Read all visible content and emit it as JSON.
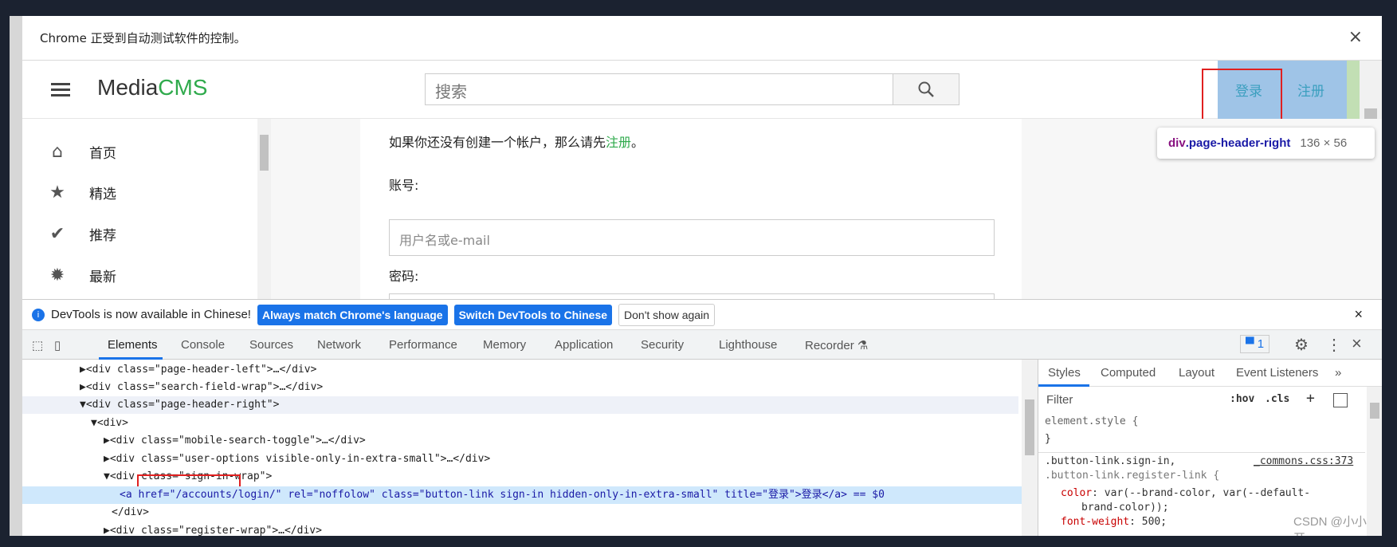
{
  "infobar": {
    "text": "Chrome 正受到自动测试软件的控制。",
    "close": "×"
  },
  "header": {
    "logo_a": "Media",
    "logo_b": "CMS",
    "search_placeholder": "搜索",
    "login": "登录",
    "register": "注册"
  },
  "sidebar": {
    "items": [
      {
        "label": "首页",
        "icon": "home-icon"
      },
      {
        "label": "精选",
        "icon": "star-icon"
      },
      {
        "label": "推荐",
        "icon": "check-icon"
      },
      {
        "label": "最新",
        "icon": "new-icon"
      }
    ]
  },
  "form": {
    "prompt": "如果你还没有创建一个帐户，那么请先",
    "prompt_link": "注册",
    "prompt_end": "。",
    "account_label": "账号:",
    "account_placeholder": "用户名或e-mail",
    "password_label": "密码:"
  },
  "tooltip": {
    "selector_tag": "div",
    "selector_class": ".page-header-right",
    "size": "136 × 56"
  },
  "banner": {
    "text": "DevTools is now available in Chinese!",
    "btn1": "Always match Chrome's language",
    "btn2": "Switch DevTools to Chinese",
    "btn3": "Don't show again",
    "close": "×"
  },
  "devtools": {
    "tabs": [
      "Elements",
      "Console",
      "Sources",
      "Network",
      "Performance",
      "Memory",
      "Application",
      "Security",
      "Lighthouse",
      "Recorder ⚗"
    ],
    "issues": "1"
  },
  "elements": {
    "rows": [
      "▶<div class=\"page-header-left\">…</div>",
      "▶<div class=\"search-field-wrap\">…</div>",
      "▼<div class=\"page-header-right\">",
      "▼<div>",
      "▶<div class=\"mobile-search-toggle\">…</div>",
      "▶<div class=\"user-options visible-only-in-extra-small\">…</div>",
      "▼<div class=\"sign-in-wrap\">",
      "<a href=\"/accounts/login/\" rel=\"noffolow\" class=\"button-link sign-in hidden-only-in-extra-small\" title=\"登录\">登录</a> == $0",
      "</div>",
      "▶<div class=\"register-wrap\">…</div>"
    ]
  },
  "styles": {
    "tabs": [
      "Styles",
      "Computed",
      "Layout",
      "Event Listeners",
      "»"
    ],
    "filter_placeholder": "Filter",
    "hov": ":hov",
    "cls": ".cls",
    "plus": "+",
    "rule0": "element.style {",
    "rule0_end": "}",
    "sel1": ".button-link.sign-in,",
    "sel2": ".button-link.register-link {",
    "source": "_commons.css:373",
    "p1n": "color",
    "p1v": ": var(--brand-color, var(--default-",
    "p1v2": "brand-color));",
    "p2n": "font-weight",
    "p2v": ": 500;"
  },
  "watermark": "CSDN @小小测开"
}
